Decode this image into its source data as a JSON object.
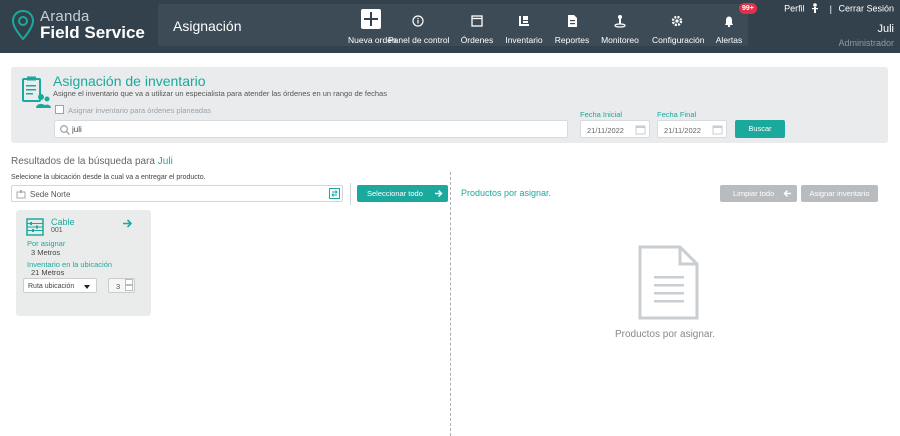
{
  "brand": {
    "line1": "Aranda",
    "line2": "Field Service"
  },
  "header": {
    "title": "Asignación",
    "nav": [
      {
        "label": "Nueva orden",
        "icon": "plus-icon"
      },
      {
        "label": "Panel de control",
        "icon": "info-icon"
      },
      {
        "label": "Órdenes",
        "icon": "window-icon"
      },
      {
        "label": "Inventario",
        "icon": "inventory-icon"
      },
      {
        "label": "Reportes",
        "icon": "report-icon"
      },
      {
        "label": "Monitoreo",
        "icon": "person-pin-icon"
      },
      {
        "label": "Configuración",
        "icon": "gear-icon"
      },
      {
        "label": "Alertas",
        "icon": "bell-icon",
        "badge": "99+"
      }
    ],
    "profile_label": "Perfil",
    "separator": "|",
    "logout_label": "Cerrar Sesión",
    "user_name": "Juli",
    "user_role": "Administrador"
  },
  "filter": {
    "title": "Asignación de inventario",
    "subtitle": "Asigne el inventario que va a utilizar un especialista para atender las órdenes en un rango de fechas",
    "checkbox_label": "Asignar inventario para órdenes planeadas",
    "search_value": "juli",
    "start_label": "Fecha Inicial",
    "start_value": "21/11/2022",
    "end_label": "Fecha Final",
    "end_value": "21/11/2022",
    "search_button": "Buscar"
  },
  "results": {
    "title_prefix": "Resultados de la búsqueda para",
    "title_query": "Juli",
    "location_label": "Selecione la ubicación desde la cual va a entregar el producto.",
    "location_value": "Sede Norte",
    "select_all": "Seleccionar todo",
    "card": {
      "name": "Cable",
      "code": "001",
      "to_assign_label": "Por asignar",
      "to_assign_value": "3 Metros",
      "stock_label": "Inventario en la ubicación",
      "stock_value": "21 Metros",
      "route_select": "Ruta ubicación",
      "qty": "3"
    }
  },
  "products": {
    "title": "Productos por asignar.",
    "clear_button": "Limpiar todo",
    "assign_button": "Asignar inventario",
    "empty_text": "Productos por asignar."
  },
  "colors": {
    "topbar": "#33414c",
    "accent": "#1ba99e",
    "panel": "#e9ebec",
    "disabled": "#b8bcbf",
    "badge": "#e0314b"
  }
}
